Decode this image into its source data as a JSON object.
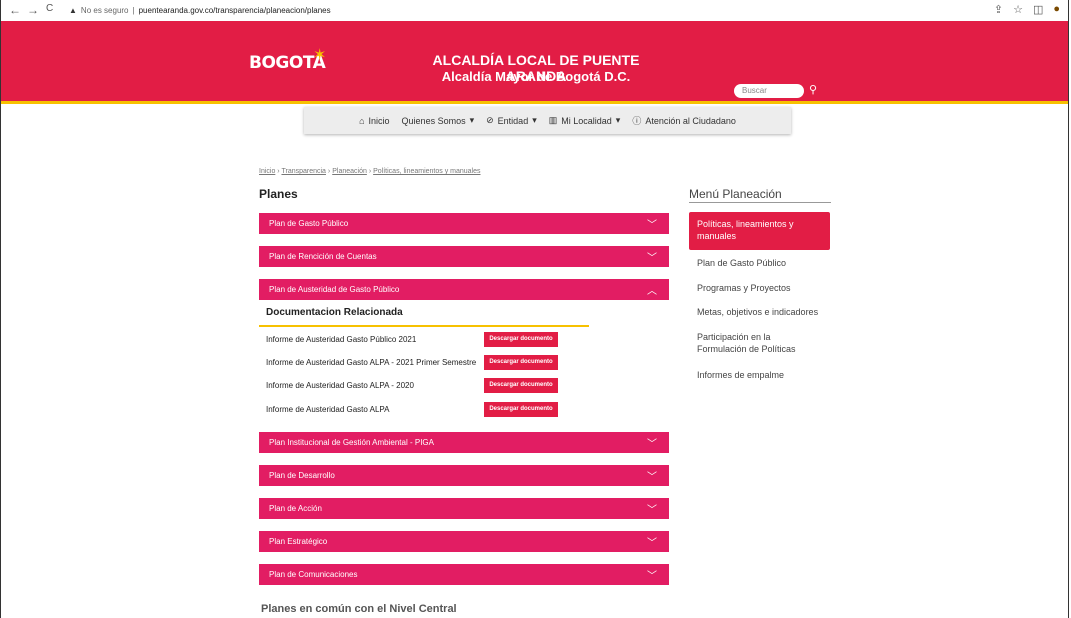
{
  "browser": {
    "back": "←",
    "forward": "→",
    "reload": "C",
    "warning": "▲",
    "security": "No es seguro",
    "host": "puentearanda.gov.co/transparencia/planeacion/planes"
  },
  "header": {
    "logo": "BOGOTA",
    "title1": "ALCALDÍA LOCAL DE PUENTE ARANDA",
    "title2": "Alcaldía Mayor de Bogotá D.C.",
    "search_placeholder": "Buscar"
  },
  "menu": {
    "inicio": "Inicio",
    "quienes": "Quienes Somos",
    "entidad": "Entidad",
    "localidad": "Mi Localidad",
    "atencion": "Atención al Ciudadano"
  },
  "breadcrumb": {
    "b1": "Inicio",
    "b2": "Transparencia",
    "b3": "Planeación",
    "b4": "Políticas, lineamientos y manuales",
    "sep": "›"
  },
  "page_title": "Planes",
  "accordion": [
    "Plan de Gasto Público",
    "Plan de Rencición de Cuentas",
    "Plan de Austeridad de Gasto Público",
    "Plan Institucional de Gestión Ambiental - PIGA",
    "Plan de Desarrollo",
    "Plan de Acción",
    "Plan Estratégico",
    "Plan de Comunicaciones"
  ],
  "docs": {
    "heading": "Documentacion Relacionada",
    "button": "Descargar documento",
    "items": [
      "Informe de Austeridad Gasto Público 2021",
      "Informe de Austeridad Gasto ALPA - 2021 Primer Semestre",
      "Informe de Austeridad Gasto ALPA - 2020",
      "Informe de Austeridad Gasto ALPA"
    ]
  },
  "sidebar": {
    "title": "Menú Planeación",
    "active": "Políticas, lineamientos y manuales",
    "items": [
      "Plan de Gasto Público",
      "Programas y Proyectos",
      "Metas, objetivos e indicadores",
      "Participación en la Formulación de Políticas",
      "Informes de empalme"
    ]
  },
  "bottom_title": "Planes en común con el Nivel Central"
}
